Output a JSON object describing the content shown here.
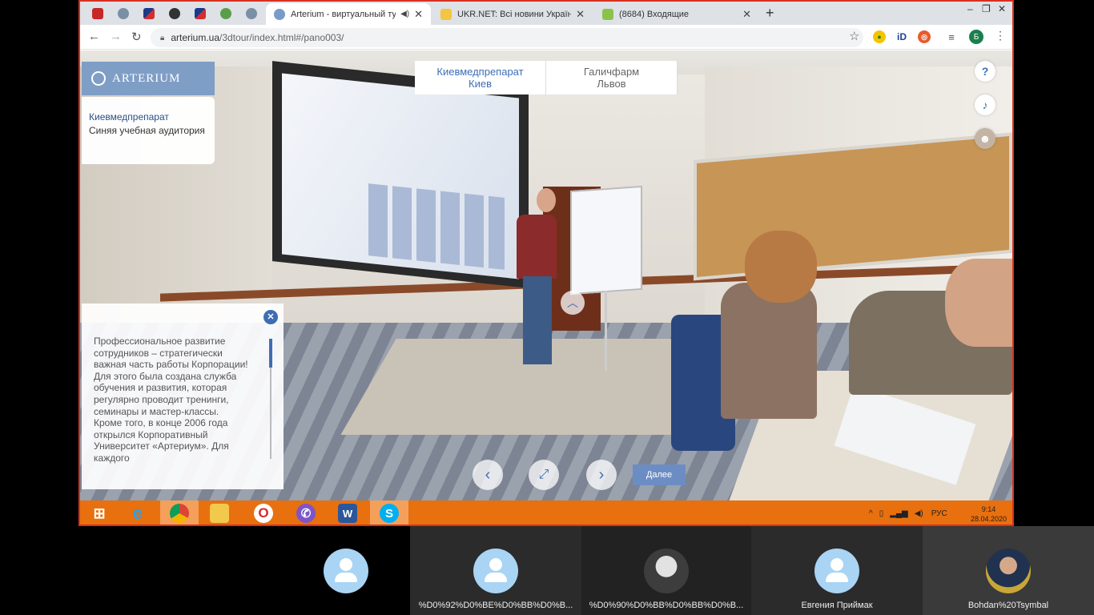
{
  "browser": {
    "tabs": [
      {
        "title": "Arterium - виртуальный тур",
        "active": true
      },
      {
        "title": "UKR.NET: Всі новини України, ос",
        "active": false
      },
      {
        "title": "(8684) Входящие",
        "active": false
      }
    ],
    "url_host": "arterium.ua",
    "url_path": "/3dtour/index.html#/pano003/",
    "profile_initial": "Б"
  },
  "tour": {
    "logo": "ARTERIUM",
    "location_site": "Киевмедпрепарат",
    "location_room": "Синяя учебная аудитория",
    "tabs": [
      {
        "line1": "Киевмедпрепарат",
        "line2": "Киев"
      },
      {
        "line1": "Галичфарм",
        "line2": "Львов"
      }
    ],
    "right_icons": [
      {
        "name": "help-icon",
        "glyph": "?"
      },
      {
        "name": "music-icon",
        "glyph": "♪"
      },
      {
        "name": "person-icon",
        "glyph": "☻"
      }
    ],
    "info_text": "Профессиональное развитие сотрудников – стратегически важная часть работы Корпорации! Для этого была создана служба обучения и развития, которая регулярно проводит тренинги, семинары и мастер-классы. Кроме того, в конце 2006 года открылся Корпоративный Университет «Артериум». Для каждого",
    "next_label": "Далее"
  },
  "taskbar": {
    "lang": "РУС",
    "time": "9:14",
    "date": "28.04.2020"
  },
  "participants": [
    {
      "name": "",
      "has_photo": false
    },
    {
      "name": "%D0%92%D0%BE%D0%BB%D0%B...",
      "has_photo": false
    },
    {
      "name": "%D0%90%D0%BB%D0%BB%D0%B...",
      "has_photo": true
    },
    {
      "name": "Евгения Приймак",
      "has_photo": false
    },
    {
      "name": "Bohdan%20Tsymbal",
      "has_photo": true
    }
  ],
  "colors": {
    "accent_blue": "#3d6eb4",
    "share_border": "#d9301f",
    "taskbar": "#e8700f"
  }
}
